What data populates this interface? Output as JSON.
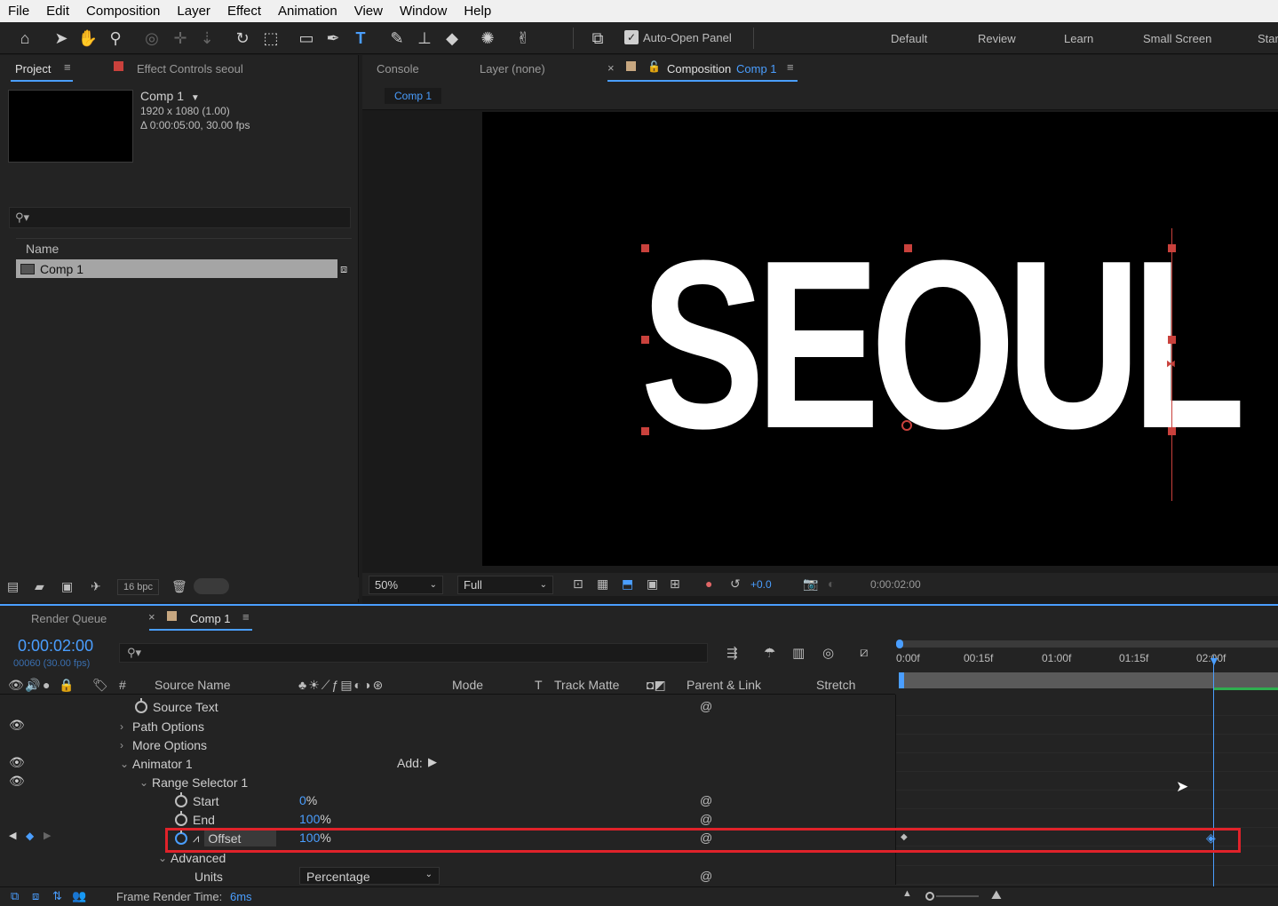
{
  "menu": [
    "File",
    "Edit",
    "Composition",
    "Layer",
    "Effect",
    "Animation",
    "View",
    "Window",
    "Help"
  ],
  "toolbar": {
    "auto_open": "Auto-Open Panel",
    "workspaces": [
      "Default",
      "Review",
      "Learn",
      "Small Screen",
      "Star"
    ]
  },
  "project": {
    "tab": "Project",
    "effect_controls": "Effect Controls seoul",
    "comp_name": "Comp 1",
    "comp_res": "1920 x 1080 (1.00)",
    "comp_dur": "Δ 0:00:05:00, 30.00 fps",
    "col_name": "Name",
    "item": "Comp 1",
    "bpc": "16 bpc"
  },
  "viewer": {
    "tabs": {
      "console": "Console",
      "layer": "Layer (none)",
      "composition": "Composition",
      "comp_link": "Comp 1"
    },
    "subtab": "Comp 1",
    "text": "SEOUL",
    "zoom": "50%",
    "quality": "Full",
    "exposure": "+0.0",
    "timecode": "0:00:02:00"
  },
  "timeline": {
    "tab_render": "Render Queue",
    "tab_comp": "Comp 1",
    "time": "0:00:02:00",
    "frames": "00060 (30.00 fps)",
    "columns": {
      "num": "#",
      "source": "Source Name",
      "mode": "Mode",
      "t": "T",
      "track": "Track Matte",
      "parent": "Parent & Link",
      "stretch": "Stretch"
    },
    "ruler": [
      "0:00f",
      "00:15f",
      "01:00f",
      "01:15f",
      "02:00f"
    ],
    "rows": {
      "source_text": "Source Text",
      "path_options": "Path Options",
      "more_options": "More Options",
      "animator": "Animator 1",
      "add": "Add:",
      "range_selector": "Range Selector 1",
      "start": "Start",
      "start_val": "0",
      "end": "End",
      "end_val": "100",
      "offset": "Offset",
      "offset_val": "100",
      "pct": "%",
      "advanced": "Advanced",
      "units": "Units",
      "units_val": "Percentage"
    },
    "footer": {
      "label": "Frame Render Time:",
      "value": "6ms"
    }
  }
}
